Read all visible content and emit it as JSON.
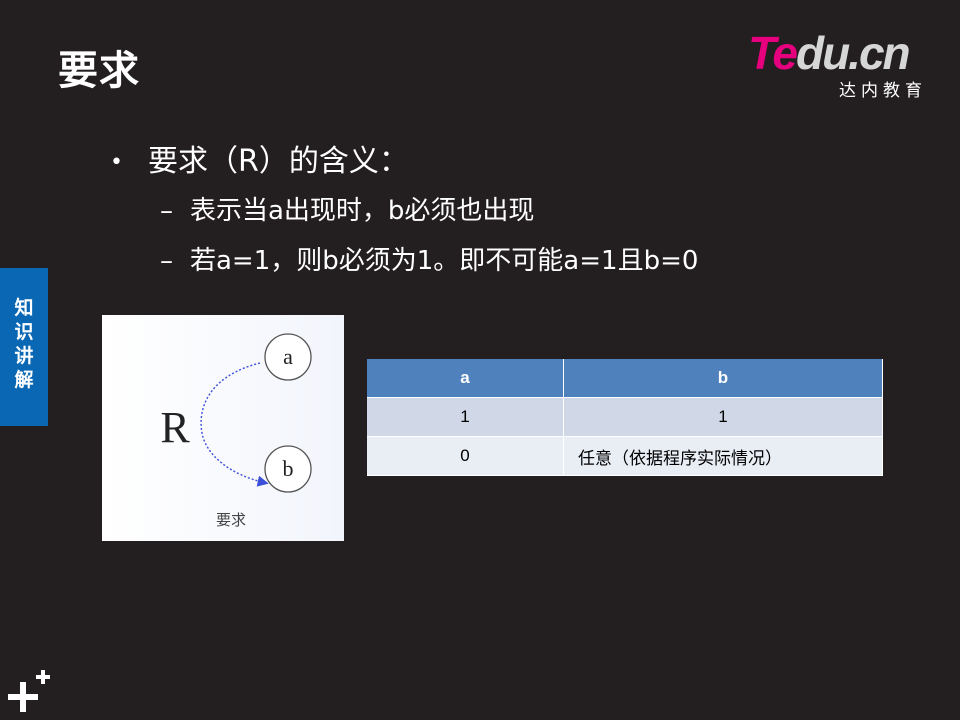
{
  "slide": {
    "title": "要求"
  },
  "logo": {
    "brand_part1": "Te",
    "brand_part2": "du.cn",
    "subtitle": "达内教育"
  },
  "side_tab": {
    "label": "知识讲解"
  },
  "bullets": {
    "main": {
      "marker": "•",
      "text": "要求（R）的含义："
    },
    "sub": [
      {
        "marker": "–",
        "text": "表示当a出现时，b必须也出现"
      },
      {
        "marker": "–",
        "text": "若a=1，则b必须为1。即不可能a=1且b=0"
      }
    ]
  },
  "diagram": {
    "relation_label": "R",
    "node_a": "a",
    "node_b": "b",
    "caption": "要求"
  },
  "table": {
    "headers": [
      "a",
      "b"
    ],
    "rows": [
      [
        "1",
        "1"
      ],
      [
        "0",
        "任意（依据程序实际情况）"
      ]
    ]
  },
  "colors": {
    "background": "#231f20",
    "side_tab": "#0a67b3",
    "table_header": "#4f81bd",
    "table_row_1": "#d0d8e8",
    "table_row_2": "#e9edf4",
    "logo_accent": "#e6007e"
  },
  "icons": {
    "corner": "plus-plus-icon"
  }
}
